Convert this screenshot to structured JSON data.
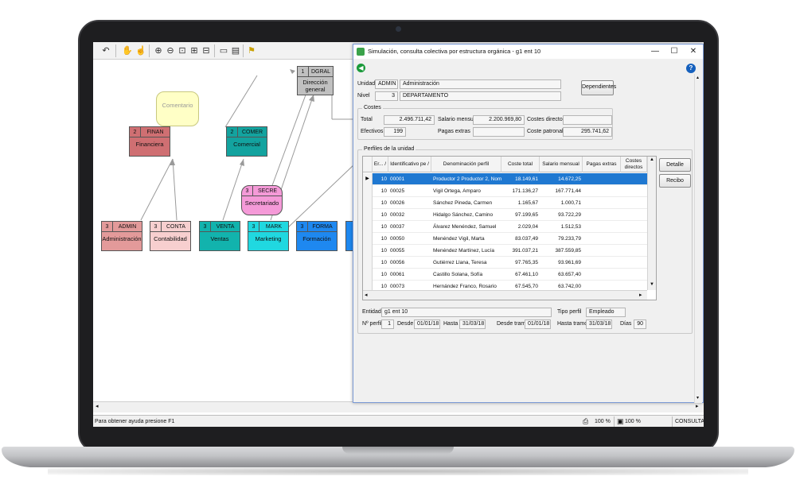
{
  "toolbar": {
    "buttons": [
      {
        "name": "undo-icon",
        "glyph": "↶"
      },
      {
        "name": "hand-icon",
        "glyph": "✋"
      },
      {
        "name": "hand-point-icon",
        "glyph": "☝"
      },
      {
        "name": "zoom-in-icon",
        "glyph": "⊕"
      },
      {
        "name": "zoom-out-icon",
        "glyph": "⊖"
      },
      {
        "name": "zoom-fit-icon",
        "glyph": "⊡"
      },
      {
        "name": "zoom-page-icon",
        "glyph": "⊞"
      },
      {
        "name": "zoom-region-icon",
        "glyph": "⊟"
      },
      {
        "name": "page-icon",
        "glyph": "▭"
      },
      {
        "name": "print-preview-icon",
        "glyph": "▤"
      },
      {
        "name": "help-pointer-icon",
        "glyph": "⚑"
      }
    ]
  },
  "diagram": {
    "comment": "Comentario",
    "nodes": [
      {
        "id": "dgral",
        "level": "1",
        "code": "DGRAL",
        "name": "Dirección general",
        "color": "#c0c0c0"
      },
      {
        "id": "finan",
        "level": "2",
        "code": "FINAN",
        "name": "Financiera",
        "color": "#cf6f72"
      },
      {
        "id": "comer",
        "level": "2",
        "code": "COMER",
        "name": "Comercial",
        "color": "#13a39f"
      },
      {
        "id": "secre",
        "level": "3",
        "code": "SECRE",
        "name": "Secretariado",
        "color": "#f59ad8"
      },
      {
        "id": "admin",
        "level": "3",
        "code": "ADMIN",
        "name": "Administración",
        "color": "#e39a9a"
      },
      {
        "id": "conta",
        "level": "3",
        "code": "CONTA",
        "name": "Contabilidad",
        "color": "#f7cfcf"
      },
      {
        "id": "venta",
        "level": "3",
        "code": "VENTA",
        "name": "Ventas",
        "color": "#12b3ad"
      },
      {
        "id": "mark",
        "level": "3",
        "code": "MARK",
        "name": "Marketing",
        "color": "#20d8e0"
      },
      {
        "id": "forma",
        "level": "3",
        "code": "FORMA",
        "name": "Formación",
        "color": "#1e88f0"
      }
    ]
  },
  "status": {
    "help": "Para obtener ayuda presione F1",
    "zoom1": "100 %",
    "zoom2": "100 %",
    "mode": "CONSULTA"
  },
  "dialog": {
    "title": "Simulación, consulta colectiva por estructura orgánica - g1 ent 10",
    "unidad_label": "Unidad",
    "unidad_code": "ADMIN",
    "unidad_name": "Administración",
    "nivel_label": "Nivel",
    "nivel_num": "3",
    "nivel_name": "DEPARTAMENTO",
    "dependientes": "Dependientes",
    "costes": {
      "title": "Costes",
      "total_label": "Total",
      "total": "2.496.711,42",
      "salario_label": "Salario mensual",
      "salario": "2.200.969,80",
      "directos_label": "Costes directos",
      "directos": "",
      "efectivos_label": "Efectivos",
      "efectivos": "199",
      "pagas_label": "Pagas extras",
      "pagas": "",
      "patronal_label": "Coste patronal",
      "patronal": "295.741,62"
    },
    "perfiles": {
      "title": "Perfiles de la unidad",
      "detalle": "Detalle",
      "recibo": "Recibo",
      "columns": [
        "Er... /",
        "Identificativo pe /",
        "Denominación perfil",
        "Coste total",
        "Salario mensual",
        "Pagas extras",
        "Costes directos"
      ],
      "rows": [
        {
          "er": "10",
          "id": "00001",
          "name": "Productor 2 Productor 2, Nomb",
          "coste": "18.149,61",
          "salario": "14.672,25",
          "pagas": "",
          "directos": ""
        },
        {
          "er": "10",
          "id": "00025",
          "name": "Vigil Ortega, Amparo",
          "coste": "171.136,27",
          "salario": "167.771,44",
          "pagas": "",
          "directos": ""
        },
        {
          "er": "10",
          "id": "00026",
          "name": "Sánchez Pineda, Carmen",
          "coste": "1.165,67",
          "salario": "1.000,71",
          "pagas": "",
          "directos": ""
        },
        {
          "er": "10",
          "id": "00032",
          "name": "Hidalgo Sánchez, Camino",
          "coste": "97.199,65",
          "salario": "93.722,29",
          "pagas": "",
          "directos": ""
        },
        {
          "er": "10",
          "id": "00037",
          "name": "Álvarez Menéndez, Samuel",
          "coste": "2.029,04",
          "salario": "1.512,53",
          "pagas": "",
          "directos": ""
        },
        {
          "er": "10",
          "id": "00050",
          "name": "Menéndez Vigil, Marta",
          "coste": "83.037,49",
          "salario": "79.233,79",
          "pagas": "",
          "directos": ""
        },
        {
          "er": "10",
          "id": "00055",
          "name": "Menéndez Martínez, Lucía",
          "coste": "391.037,21",
          "salario": "387.559,85",
          "pagas": "",
          "directos": ""
        },
        {
          "er": "10",
          "id": "00056",
          "name": "Gutiérrez Llana, Teresa",
          "coste": "97.765,35",
          "salario": "93.961,69",
          "pagas": "",
          "directos": ""
        },
        {
          "er": "10",
          "id": "00061",
          "name": "Castillo Solana, Sofía",
          "coste": "67.461,10",
          "salario": "63.657,40",
          "pagas": "",
          "directos": ""
        },
        {
          "er": "10",
          "id": "00073",
          "name": "Hernández Franco, Rosario",
          "coste": "67.545,70",
          "salario": "63.742,00",
          "pagas": "",
          "directos": ""
        }
      ]
    },
    "footer": {
      "entidad_label": "Entidad",
      "entidad": "g1 ent 10",
      "tipo_label": "Tipo perfil",
      "tipo": "Empleado",
      "nperfil_label": "Nº perfil",
      "nperfil": "1",
      "desde_label": "Desde",
      "desde": "01/01/18",
      "hasta_label": "Hasta",
      "hasta": "31/03/18",
      "desde_tramo_label": "Desde tramo",
      "desde_tramo": "01/01/18",
      "hasta_tramo_label": "Hasta tramo",
      "hasta_tramo": "31/03/18",
      "dias_label": "Días",
      "dias": "90"
    }
  }
}
